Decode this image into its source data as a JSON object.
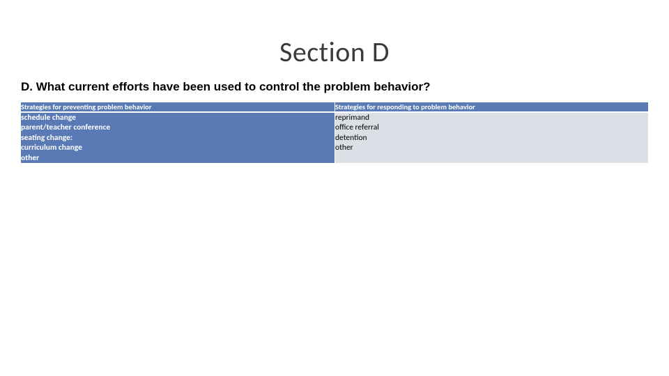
{
  "title": "Section D",
  "question": "D. What current efforts have been used to control the problem behavior?",
  "table": {
    "headers": {
      "left": "Strategies for preventing problem behavior",
      "right": "Strategies for responding to problem behavior"
    },
    "left_items": [
      "schedule change",
      "parent/teacher conference",
      "seating change:",
      "curriculum change",
      "other"
    ],
    "right_items": [
      "reprimand",
      "office referral",
      "detention",
      "other"
    ]
  }
}
